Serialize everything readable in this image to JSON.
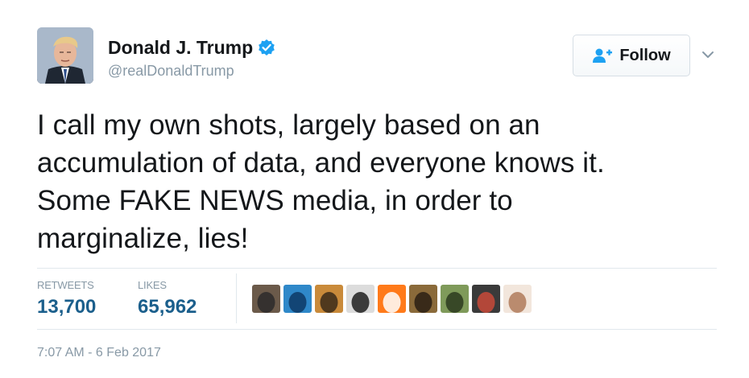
{
  "user": {
    "display_name": "Donald J. Trump",
    "handle": "@realDonaldTrump",
    "verified": true
  },
  "follow_button": {
    "label": "Follow",
    "icon": "add-user-icon"
  },
  "tweet": {
    "lines": [
      "I call my own shots, largely based on an",
      "accumulation of data, and everyone knows it.",
      "Some FAKE NEWS media, in order to",
      "marginalize, lies!"
    ],
    "timestamp": "7:07 AM - 6 Feb 2017"
  },
  "stats": {
    "retweets_label": "RETWEETS",
    "retweets_value": "13,700",
    "likes_label": "LIKES",
    "likes_value": "65,962"
  },
  "likers": [
    {
      "icon": "liker-avatar-1",
      "colors": [
        "#6b5a4a",
        "#2c2a2a"
      ]
    },
    {
      "icon": "liker-avatar-2",
      "colors": [
        "#2f88c9",
        "#0d3a66"
      ]
    },
    {
      "icon": "liker-avatar-3",
      "colors": [
        "#c98a3a",
        "#3b2a1a"
      ]
    },
    {
      "icon": "liker-avatar-4",
      "colors": [
        "#dcdcdc",
        "#1e1e1e"
      ]
    },
    {
      "icon": "liker-avatar-5",
      "colors": [
        "#ff7a1a",
        "#ffffff"
      ]
    },
    {
      "icon": "liker-avatar-6",
      "colors": [
        "#8a6a3a",
        "#2a1e14"
      ]
    },
    {
      "icon": "liker-avatar-7",
      "colors": [
        "#7f9a5a",
        "#2c3a1e"
      ]
    },
    {
      "icon": "liker-avatar-8",
      "colors": [
        "#3a3a3a",
        "#c94a3a"
      ]
    },
    {
      "icon": "liker-avatar-9",
      "colors": [
        "#f2e6dc",
        "#b07a5a"
      ]
    }
  ],
  "colors": {
    "accent": "#1b5f8c",
    "verified": "#1da1f2",
    "muted": "#8899a6"
  }
}
